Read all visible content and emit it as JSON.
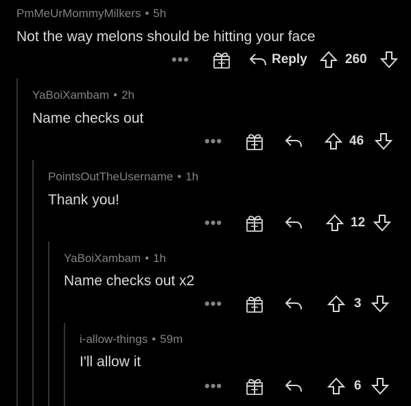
{
  "comments": [
    {
      "username": "PmMeUrMommyMilkers",
      "age": "5h",
      "text": "Not the way melons should be hitting your face",
      "more": "•••",
      "reply_label": "Reply",
      "score": "260"
    },
    {
      "username": "YaBoiXambam",
      "age": "2h",
      "text": "Name checks out",
      "more": "•••",
      "score": "46"
    },
    {
      "username": "PointsOutTheUsername",
      "age": "1h",
      "text": "Thank you!",
      "more": "•••",
      "score": "12"
    },
    {
      "username": "YaBoiXambam",
      "age": "1h",
      "text": "Name checks out x2",
      "more": "•••",
      "score": "3"
    },
    {
      "username": "i-allow-things",
      "age": "59m",
      "text": "I'll allow it",
      "more": "•••",
      "score": "6"
    }
  ],
  "separator": "•",
  "colors": {
    "background": "#000000",
    "text": "#d7dadc",
    "meta": "#818384",
    "thread_line": "#343536"
  }
}
